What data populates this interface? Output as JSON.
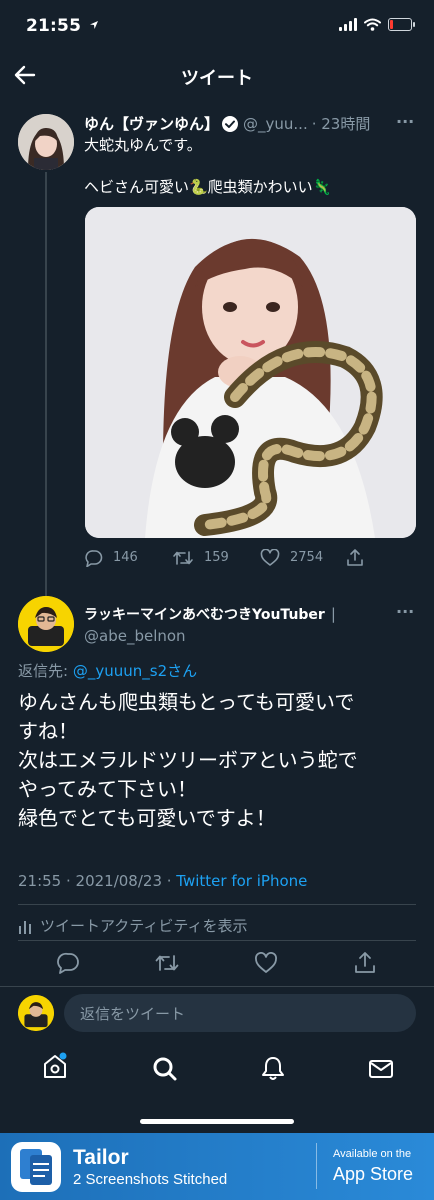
{
  "status_bar": {
    "time": "21:55"
  },
  "header": {
    "title": "ツイート"
  },
  "tweet": {
    "author_name": "ゆん【ヴァンゆん】",
    "handle": "@_yuu...",
    "time_ago": "· 23時間",
    "more": "···",
    "line1": "大蛇丸ゆんです。",
    "line2": "ヘビさん可愛い🐍爬虫類かわいい🦎",
    "replies": "146",
    "retweets": "159",
    "likes": "2754"
  },
  "reply": {
    "author_name": "ラッキーマインあべむつきYouTuber",
    "separator": "|",
    "handle": "@abe_belnon",
    "more": "···",
    "replying_to_label": "返信先:",
    "replying_to_user": "@_yuuun_s2さん",
    "text_lines": [
      "ゆんさんも爬虫類もとっても可愛いで",
      "すね！",
      "次はエメラルドツリーボアという蛇で",
      "やってみて下さい！",
      "緑色でとても可愛いですよ！"
    ],
    "timestamp": "21:55 · 2021/08/23 · ",
    "client": "Twitter for iPhone",
    "activity_label": "ツイートアクティビティを表示"
  },
  "composer": {
    "placeholder": "返信をツイート"
  },
  "banner": {
    "app_name": "Tailor",
    "subtitle": "2 Screenshots Stitched",
    "store_small": "Available on the",
    "store_big": "App Store"
  },
  "colors": {
    "background": "#15202b",
    "muted": "#8899a6",
    "accent": "#1da1f2",
    "divider": "#38444d"
  }
}
